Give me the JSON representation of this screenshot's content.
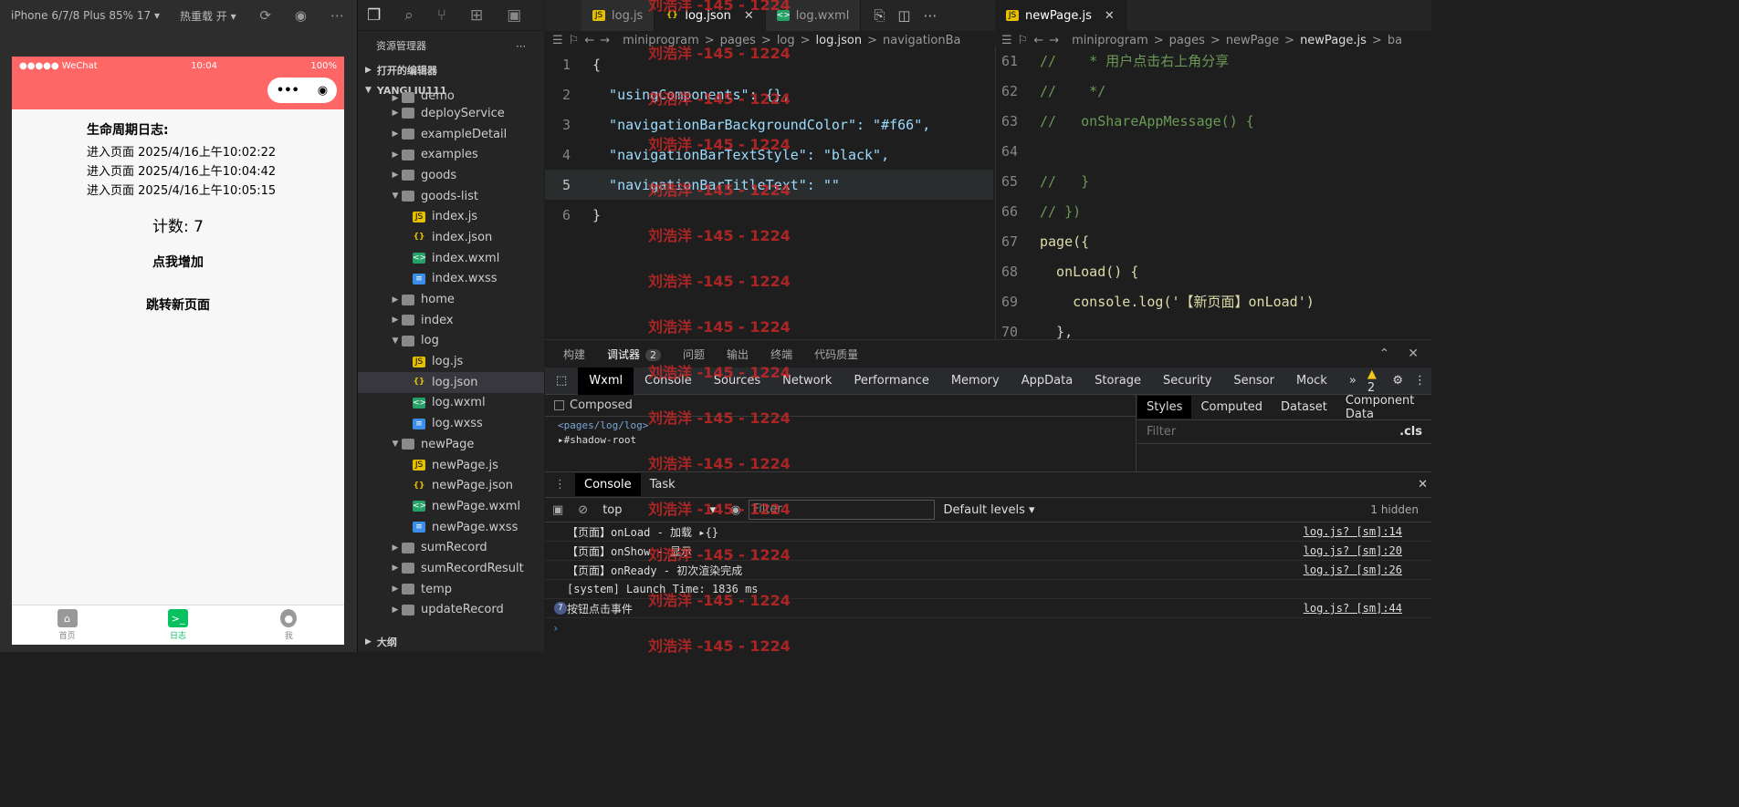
{
  "simulator": {
    "device": "iPhone 6/7/8 Plus 85% 17 ▾",
    "hot_reload": "热重载 开 ▾",
    "status_carrier": "●●●●● WeChat",
    "status_time": "10:04",
    "status_battery": "100%",
    "lifecycle_title": "生命周期日志:",
    "log_entries": [
      "进入页面 2025/4/16上午10:02:22",
      "进入页面 2025/4/16上午10:04:42",
      "进入页面 2025/4/16上午10:05:15"
    ],
    "count_text": "计数: 7",
    "increase_button": "点我增加",
    "navigate_button": "跳转新页面",
    "tabs": [
      {
        "label": "首页"
      },
      {
        "label": "日志"
      },
      {
        "label": "我"
      }
    ]
  },
  "explorer": {
    "title": "资源管理器",
    "open_editors": "打开的编辑器",
    "project": "YANGLIU111",
    "outline": "大纲",
    "tree": [
      {
        "label": "demo",
        "type": "folder"
      },
      {
        "label": "deployService",
        "type": "folder"
      },
      {
        "label": "exampleDetail",
        "type": "folder"
      },
      {
        "label": "examples",
        "type": "folder"
      },
      {
        "label": "goods",
        "type": "folder"
      },
      {
        "label": "goods-list",
        "type": "folder"
      },
      {
        "label": "index.js",
        "type": "js"
      },
      {
        "label": "index.json",
        "type": "json"
      },
      {
        "label": "index.wxml",
        "type": "wxml"
      },
      {
        "label": "index.wxss",
        "type": "wxss"
      },
      {
        "label": "home",
        "type": "folder"
      },
      {
        "label": "index",
        "type": "folder"
      },
      {
        "label": "log",
        "type": "folder"
      },
      {
        "label": "log.js",
        "type": "js"
      },
      {
        "label": "log.json",
        "type": "json"
      },
      {
        "label": "log.wxml",
        "type": "wxml"
      },
      {
        "label": "log.wxss",
        "type": "wxss"
      },
      {
        "label": "newPage",
        "type": "folder"
      },
      {
        "label": "newPage.js",
        "type": "js"
      },
      {
        "label": "newPage.json",
        "type": "json"
      },
      {
        "label": "newPage.wxml",
        "type": "wxml"
      },
      {
        "label": "newPage.wxss",
        "type": "wxss"
      },
      {
        "label": "sumRecord",
        "type": "folder"
      },
      {
        "label": "sumRecordResult",
        "type": "folder"
      },
      {
        "label": "temp",
        "type": "folder"
      },
      {
        "label": "updateRecord",
        "type": "folder"
      }
    ]
  },
  "editor_left": {
    "tabs": [
      "log.js",
      "log.json",
      "log.wxml"
    ],
    "breadcrumb": [
      "miniprogram",
      ">",
      "pages",
      ">",
      "log",
      ">",
      "log.json",
      ">",
      "navigationBa"
    ],
    "line_numbers": [
      "1",
      "2",
      "3",
      "4",
      "5",
      "6"
    ],
    "lines": [
      "{",
      "  \"usingComponents\": {},",
      "  \"navigationBarBackgroundColor\": \"#f66\",",
      "  \"navigationBarTextStyle\": \"black\",",
      "  \"navigationBarTitleText\": \"\"",
      "}"
    ]
  },
  "editor_right": {
    "tabs": [
      "newPage.js"
    ],
    "breadcrumb": [
      "miniprogram",
      ">",
      "pages",
      ">",
      "newPage",
      ">",
      "newPage.js",
      ">",
      "ba"
    ],
    "line_numbers": [
      "61",
      "62",
      "63",
      "64",
      "65",
      "66",
      "67",
      "68",
      "69",
      "70"
    ],
    "lines": [
      "//    * 用户点击右上角分享",
      "//    */",
      "//   onShareAppMessage() {",
      "",
      "//   }",
      "// })",
      "page({",
      "  onLoad() {",
      "    console.log('【新页面】onLoad')",
      "  },"
    ]
  },
  "devtools": {
    "top_tabs": [
      "构建",
      "调试器",
      "问题",
      "输出",
      "终端",
      "代码质量"
    ],
    "debugger_badge": "2",
    "panel_tabs": [
      "Wxml",
      "Console",
      "Sources",
      "Network",
      "Performance",
      "Memory",
      "AppData",
      "Storage",
      "Security",
      "Sensor",
      "Mock"
    ],
    "warning_count": "2",
    "composed": "Composed",
    "wxml_path": "<pages/log/log>",
    "shadow_root": "#shadow-root",
    "style_tabs": [
      "Styles",
      "Computed",
      "Dataset",
      "Component Data"
    ],
    "filter_placeholder": "Filter",
    "cls": ".cls",
    "console_tabs": [
      "Console",
      "Task"
    ],
    "context": "top",
    "levels": "Default levels ▾",
    "hidden": "1 hidden",
    "console_lines": [
      {
        "text": "【页面】onLoad - 加载 ▸{}",
        "src": "log.js? [sm]:14"
      },
      {
        "text": "【页面】onShow - 显示",
        "src": "log.js? [sm]:20"
      },
      {
        "text": "【页面】onReady - 初次渲染完成",
        "src": "log.js? [sm]:26"
      },
      {
        "text": "[system] Launch Time: 1836 ms",
        "src": ""
      },
      {
        "text": "按钮点击事件",
        "src": "log.js? [sm]:44",
        "count": "7"
      }
    ]
  },
  "watermark": "刘浩洋 -145 - 1224"
}
